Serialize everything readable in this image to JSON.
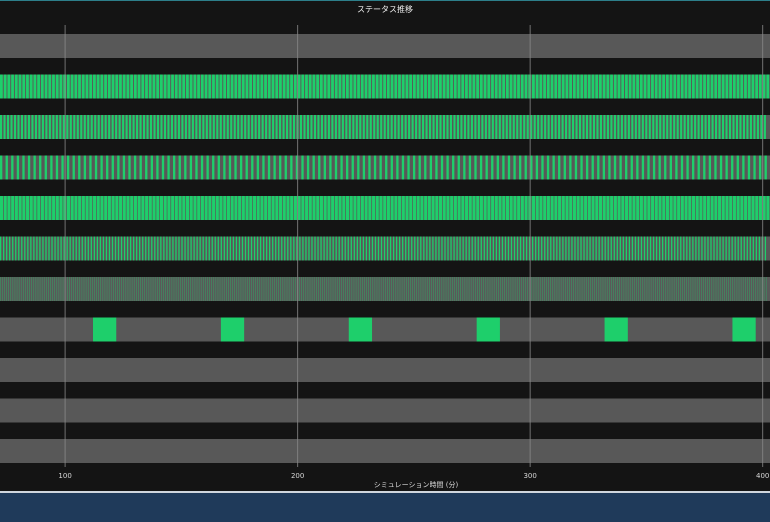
{
  "colors": {
    "background": "#141414",
    "lane": "#585858",
    "active": "#1ecf6b",
    "grid": "#8a8a8a",
    "bottom_panel": "#1f3a5a"
  },
  "chart_data": {
    "type": "timeline",
    "title": "ステータス推移",
    "xlabel": "シミュレーション時間 (分)",
    "xlim": [
      72,
      401
    ],
    "xticks": [
      100,
      200,
      300,
      400
    ],
    "xtick_labels": [
      "100",
      "200",
      "300",
      "400"
    ],
    "grid": true,
    "legend": "none",
    "lanes": [
      {
        "pattern": "none"
      },
      {
        "pattern": "periodic",
        "period": 1.6,
        "on": 1.2
      },
      {
        "pattern": "periodic",
        "period": 1.5,
        "on": 0.9
      },
      {
        "pattern": "periodic",
        "period": 2.4,
        "on": 1.0
      },
      {
        "pattern": "periodic",
        "period": 1.6,
        "on": 1.3
      },
      {
        "pattern": "periodic",
        "period": 1.3,
        "on": 0.55
      },
      {
        "pattern": "periodic",
        "period": 0.9,
        "on": 0.25
      },
      {
        "pattern": "intervals",
        "intervals": [
          [
            112,
            122
          ],
          [
            167,
            177
          ],
          [
            222,
            232
          ],
          [
            277,
            287
          ],
          [
            332,
            342
          ],
          [
            387,
            397
          ]
        ]
      },
      {
        "pattern": "none"
      },
      {
        "pattern": "none"
      },
      {
        "pattern": "none"
      }
    ]
  }
}
